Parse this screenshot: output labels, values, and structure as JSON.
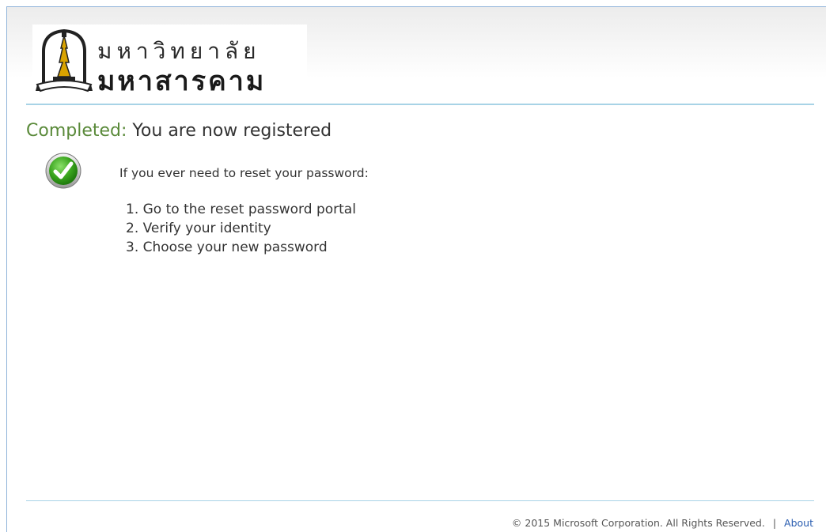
{
  "header": {
    "logo_line1": "มหาวิทยาลัย",
    "logo_line2": "มหาสารคาม"
  },
  "status": {
    "completed_label": "Completed:",
    "message": "You are now registered"
  },
  "content": {
    "intro": "If you ever need to reset your password:",
    "steps": [
      "1. Go to the reset password portal",
      "2. Verify your identity",
      "3. Choose your new password"
    ]
  },
  "footer": {
    "copyright": "© 2015 Microsoft Corporation. All Rights Reserved.",
    "separator": "|",
    "about_link": "About"
  },
  "colors": {
    "accent_green": "#5a8a3a",
    "divider": "#a8d3e6",
    "link": "#2a5db0"
  },
  "icons": {
    "success": "checkmark-circle-icon",
    "logo": "university-emblem-icon"
  }
}
